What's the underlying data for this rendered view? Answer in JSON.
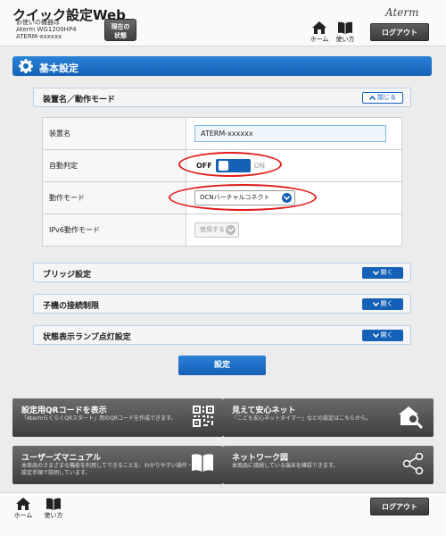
{
  "header": {
    "app_title": "クイック設定Web",
    "device_lines": [
      "お使いの機器は",
      "Aterm WG1200HP4",
      "ATERM-xxxxxx"
    ],
    "status_button": [
      "現在の",
      "状態"
    ],
    "brand": "Aterm",
    "nav": {
      "home": "ホーム",
      "manual": "使い方"
    },
    "logout": "ログアウト"
  },
  "section": {
    "title": "基本設定"
  },
  "cards": {
    "device_mode": {
      "label": "装置名／動作モード",
      "collapse": "閉じる"
    },
    "bridge": {
      "label": "ブリッジ設定",
      "expand": "開く"
    },
    "child_limit": {
      "label": "子機の接続制限",
      "expand": "開く"
    },
    "lamp": {
      "label": "状態表示ランプ点灯設定",
      "expand": "開く"
    }
  },
  "settings": {
    "device_name": {
      "label": "装置名",
      "value": "ATERM-xxxxxx"
    },
    "auto_detect": {
      "label": "自動判定",
      "off": "OFF",
      "on": "ON",
      "state": "off"
    },
    "operation_mode": {
      "label": "動作モード",
      "value": "OCNバーチャルコネクト"
    },
    "ipv6_mode": {
      "label": "IPv6動作モード",
      "value": "使用する"
    }
  },
  "submit": "設定",
  "tiles": {
    "qr": {
      "title": "設定用QRコードを表示",
      "desc": "「AtermらくらくQRスタート」用のQRコードを作成できます。"
    },
    "safe_net": {
      "title": "見えて安心ネット",
      "desc": "「こども安心ネットタイマー」などの設定はこちらから。"
    },
    "user_manual": {
      "title": "ユーザーズマニュアル",
      "desc": "本商品のさまざまな機能を利用してできることを、わかりやすい操作・設定手順で説明しています。"
    },
    "network_map": {
      "title": "ネットワーク図",
      "desc": "本商品に接続している端末を確認できます。"
    }
  },
  "footer": {
    "nav": {
      "home": "ホーム",
      "manual": "使い方"
    },
    "logout": "ログアウト"
  },
  "colors": {
    "accent": "#1561b7",
    "highlight": "#e21b1b",
    "tile": "#4f4f4f"
  }
}
